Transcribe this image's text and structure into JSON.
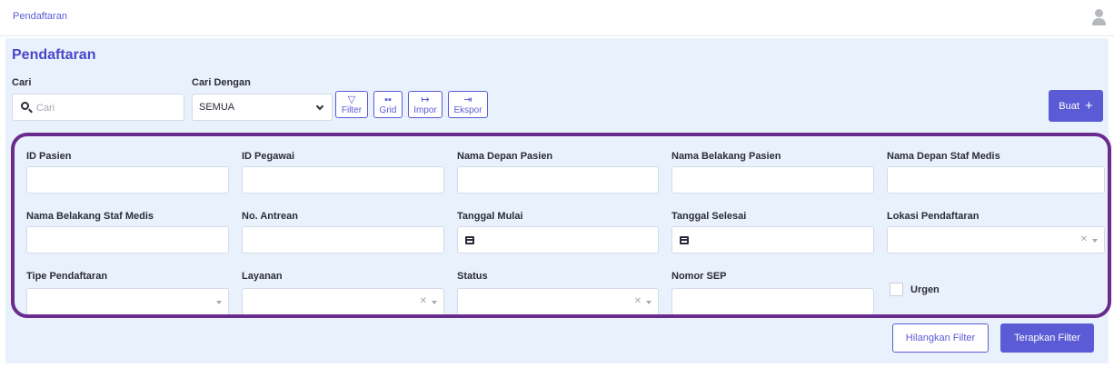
{
  "header": {
    "breadcrumb": "Pendaftaran"
  },
  "page": {
    "title": "Pendaftaran"
  },
  "search": {
    "label": "Cari",
    "placeholder": "Cari",
    "value": ""
  },
  "search_by": {
    "label": "Cari Dengan",
    "value": "SEMUA"
  },
  "toolbar": {
    "filter_label": "Filter",
    "grid_label": "Grid",
    "import_label": "Impor",
    "export_label": "Ekspor",
    "create_label": "Buat"
  },
  "filters": {
    "id_pasien": "ID Pasien",
    "id_pegawai": "ID Pegawai",
    "nama_depan_pasien": "Nama Depan Pasien",
    "nama_belakang_pasien": "Nama Belakang Pasien",
    "nama_depan_staf": "Nama Depan Staf Medis",
    "nama_belakang_staf": "Nama Belakang Staf Medis",
    "no_antrean": "No. Antrean",
    "tanggal_mulai": "Tanggal Mulai",
    "tanggal_selesai": "Tanggal Selesai",
    "lokasi": "Lokasi Pendaftaran",
    "tipe": "Tipe Pendaftaran",
    "layanan": "Layanan",
    "status": "Status",
    "nomor_sep": "Nomor SEP",
    "urgen": "Urgen"
  },
  "actions": {
    "clear_label": "Hilangkan Filter",
    "apply_label": "Terapkan Filter"
  },
  "colors": {
    "accent": "#5b5bd6",
    "panel_bg": "#e9f2fc",
    "highlight_border": "#6a2b8f"
  }
}
